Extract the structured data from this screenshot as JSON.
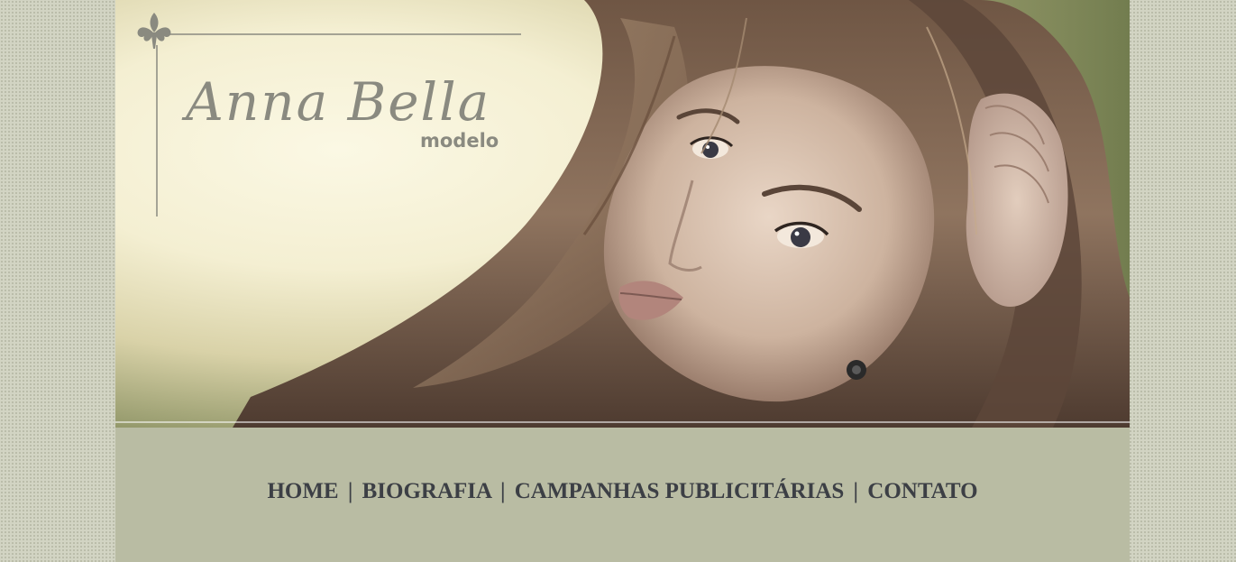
{
  "brand": {
    "name": "Anna Bella",
    "tagline": "modelo"
  },
  "nav": {
    "items": [
      {
        "label": "HOME"
      },
      {
        "label": "BIOGRAFIA"
      },
      {
        "label": "CAMPANHAS PUBLICITÁRIAS"
      },
      {
        "label": "CONTATO"
      }
    ],
    "separator": "|"
  },
  "colors": {
    "page_background": "#d2d4c3",
    "nav_band": "#b9bca3",
    "nav_text": "#3c3f45",
    "logo_text": "#8a8a80"
  },
  "icons": {
    "logo_ornament": "fleur-de-lis-icon"
  }
}
